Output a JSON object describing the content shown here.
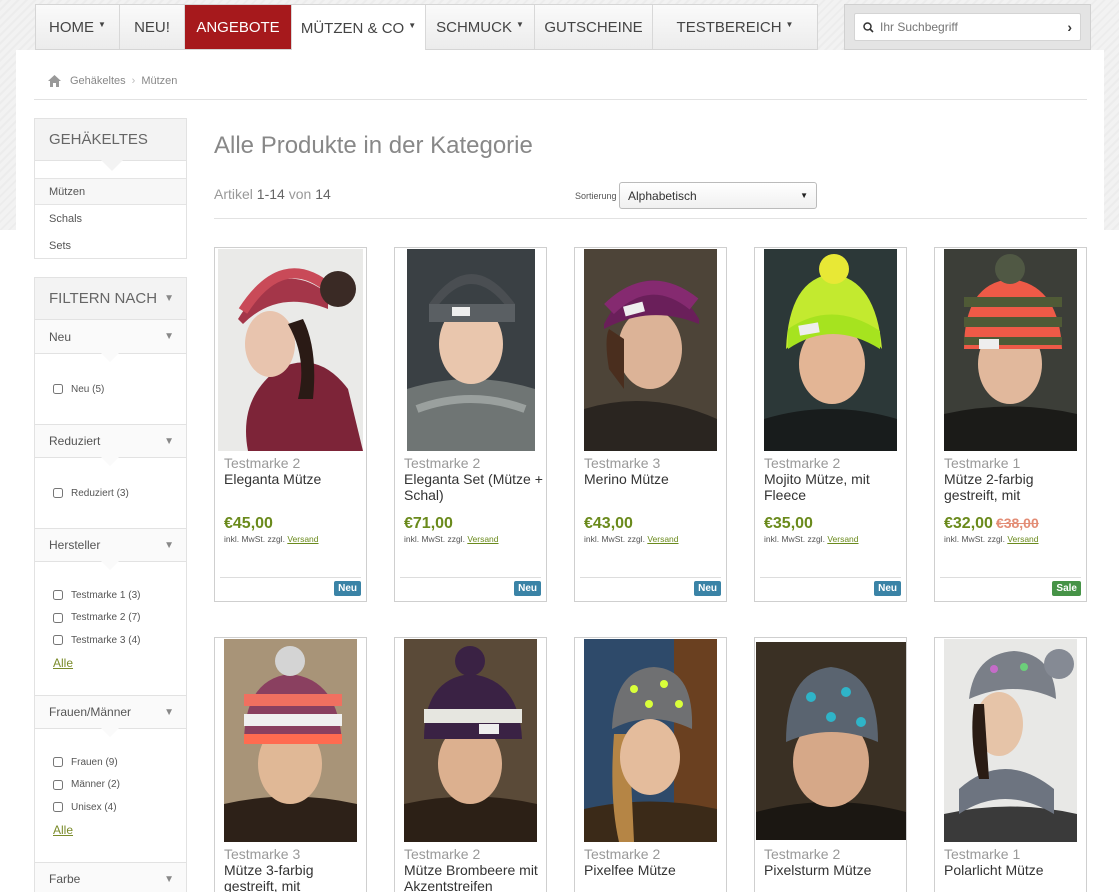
{
  "nav": {
    "items": [
      {
        "label": "Home",
        "caret": true
      },
      {
        "label": "Neu!",
        "caret": false
      },
      {
        "label": "Angebote",
        "caret": false
      },
      {
        "label": "Mützen & Co",
        "caret": true
      },
      {
        "label": "Schmuck",
        "caret": true
      },
      {
        "label": "Gutscheine",
        "caret": false
      },
      {
        "label": "Testbereich",
        "caret": true
      }
    ]
  },
  "search": {
    "placeholder": "Ihr Suchbegriff"
  },
  "breadcrumb": {
    "level1": "Gehäkeltes",
    "level2": "Mützen"
  },
  "sidebar": {
    "category_title": "Gehäkeltes",
    "categories": [
      "Mützen",
      "Schals",
      "Sets"
    ],
    "filter_title": "Filtern nach",
    "groups": {
      "neu": {
        "title": "Neu",
        "options": [
          "Neu (5)"
        ]
      },
      "reduziert": {
        "title": "Reduziert",
        "options": [
          "Reduziert (3)"
        ]
      },
      "hersteller": {
        "title": "Hersteller",
        "options": [
          "Testmarke 1 (3)",
          "Testmarke 2 (7)",
          "Testmarke 3 (4)"
        ],
        "all": "Alle"
      },
      "gender": {
        "title": "Frauen/Männer",
        "options": [
          "Frauen (9)",
          "Männer (2)",
          "Unisex (4)"
        ],
        "all": "Alle"
      },
      "farbe": {
        "title": "Farbe"
      }
    }
  },
  "content": {
    "title": "Alle Produkte in der Kategorie",
    "count_prefix": "Artikel",
    "count_range": "1-14",
    "count_mid": "von",
    "count_total": "14",
    "sort_label": "Sortierung",
    "sort_value": "Alphabetisch"
  },
  "products": [
    {
      "brand": "Testmarke 2",
      "name": "Eleganta Mütze",
      "price": "€45,00",
      "tax_prefix": "inkl. MwSt. zzgl.",
      "shipping": "Versand",
      "badge": "Neu"
    },
    {
      "brand": "Testmarke 2",
      "name": "Eleganta Set (Mütze + Schal)",
      "price": "€71,00",
      "tax_prefix": "inkl. MwSt. zzgl.",
      "shipping": "Versand",
      "badge": "Neu"
    },
    {
      "brand": "Testmarke 3",
      "name": "Merino Mütze",
      "price": "€43,00",
      "tax_prefix": "inkl. MwSt. zzgl.",
      "shipping": "Versand",
      "badge": "Neu"
    },
    {
      "brand": "Testmarke 2",
      "name": "Mojito Mütze, mit Fleece",
      "price": "€35,00",
      "tax_prefix": "inkl. MwSt. zzgl.",
      "shipping": "Versand",
      "badge": "Neu"
    },
    {
      "brand": "Testmarke 1",
      "name": "Mütze 2-farbig gestreift, mit",
      "price": "€32,00",
      "old_price": "€38,00",
      "tax_prefix": "inkl. MwSt. zzgl.",
      "shipping": "Versand",
      "badge": "Sale"
    },
    {
      "brand": "Testmarke 3",
      "name": "Mütze 3-farbig gestreift, mit"
    },
    {
      "brand": "Testmarke 2",
      "name": "Mütze Brombeere mit Akzentstreifen"
    },
    {
      "brand": "Testmarke 2",
      "name": "Pixelfee Mütze"
    },
    {
      "brand": "Testmarke 2",
      "name": "Pixelsturm Mütze"
    },
    {
      "brand": "Testmarke 1",
      "name": "Polarlicht Mütze"
    }
  ],
  "colors": {
    "accent_red": "#a6191c",
    "price_green": "#6a8a1c",
    "badge_new": "#3a83a6",
    "badge_sale": "#469347"
  }
}
